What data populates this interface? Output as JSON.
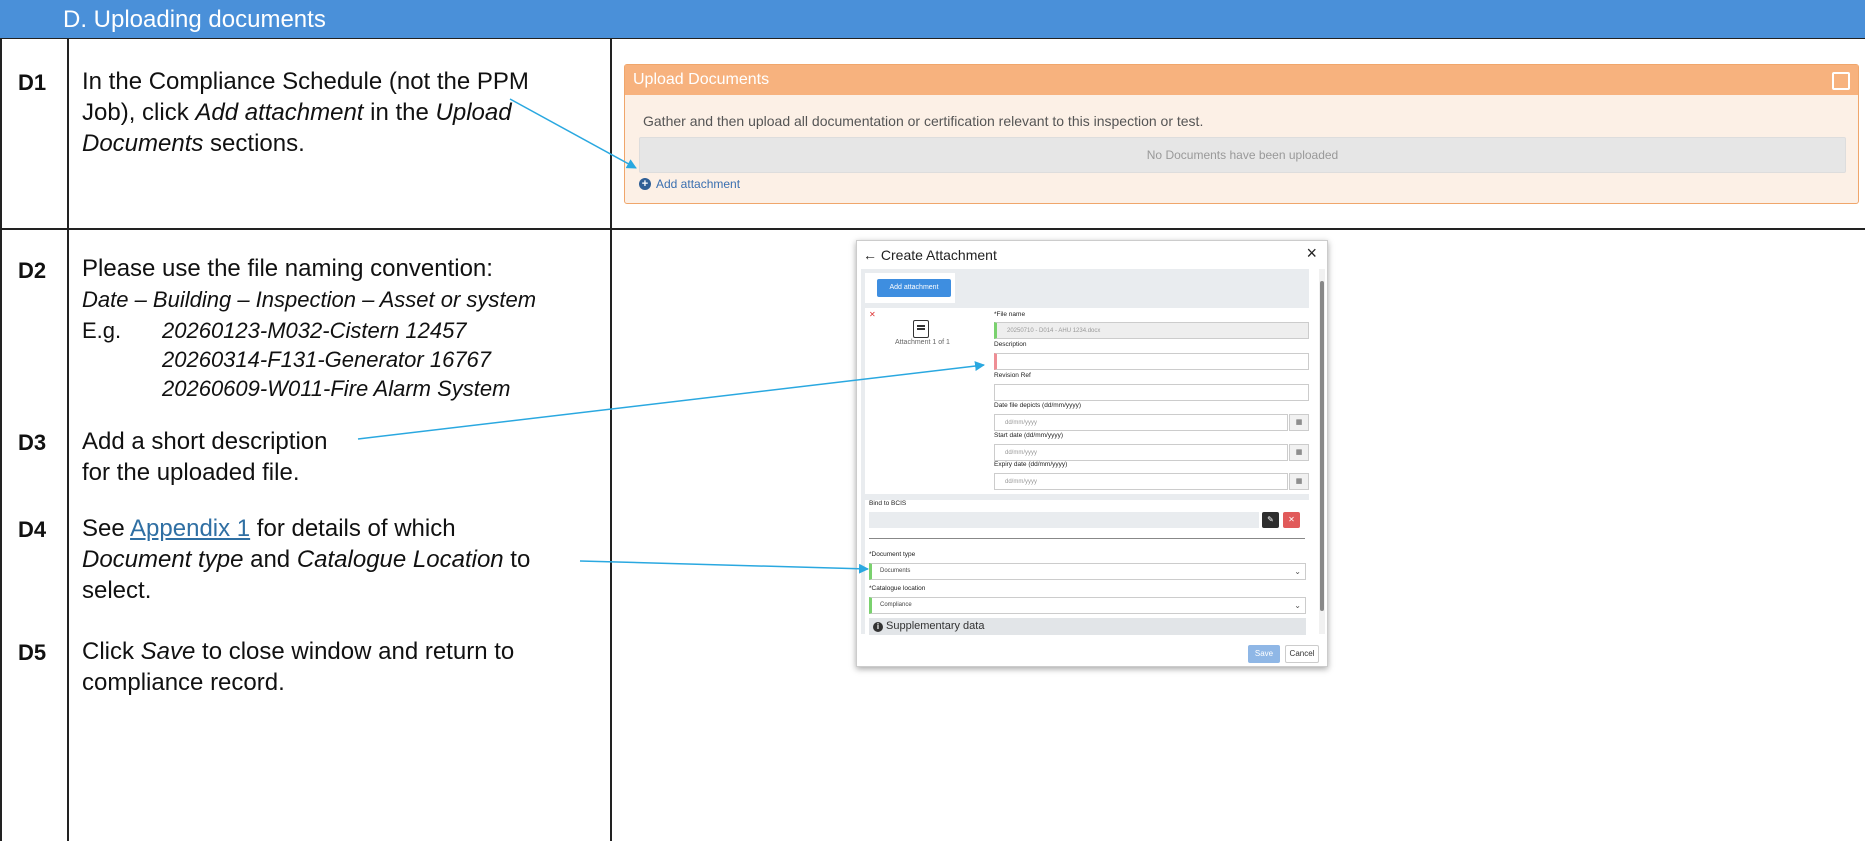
{
  "section": {
    "title": "D.  Uploading documents"
  },
  "steps": {
    "d1": {
      "id": "D1",
      "line1_a": "In the Compliance Schedule (not the PPM",
      "line2_a": "Job), click ",
      "line2_b": "Add attachment",
      "line2_c": " in the ",
      "line2_d": "Upload",
      "line3_a": "Documents",
      "line3_b": " sections."
    },
    "d2": {
      "id": "D2",
      "line1": "Please use the file naming convention:",
      "line2": "Date – Building – Inspection – Asset or system",
      "eg_label": "E.g.",
      "examples": [
        "20260123-M032-Cistern 12457",
        "20260314-F131-Generator 16767",
        "20260609-W011-Fire Alarm System"
      ]
    },
    "d3": {
      "id": "D3",
      "line1": "Add a short description",
      "line2": "for the uploaded file."
    },
    "d4": {
      "id": "D4",
      "see": "See ",
      "link": "Appendix 1",
      "rest": " for details of which",
      "line2_a": "Document type",
      "line2_b": " and ",
      "line2_c": "Catalogue Location",
      "line2_d": " to",
      "line3": "select."
    },
    "d5": {
      "id": "D5",
      "line1_a": "Click ",
      "line1_b": "Save",
      "line1_c": " to close window and return to",
      "line2": "compliance record."
    }
  },
  "upload_panel": {
    "title": "Upload Documents",
    "description": "Gather and then upload all documentation or certification relevant to this inspection or test.",
    "empty_text": "No Documents have been uploaded",
    "add_attachment": "Add attachment"
  },
  "dialog": {
    "title": "← Create Attachment",
    "close": "×",
    "add_attachment_btn": "Add attachment",
    "attachment_count": "Attachment 1 of 1",
    "file_name_label": "*File name",
    "file_name_value": "20250710 - D014 - AHU 1234.docx",
    "description_label": "Description",
    "revision_label": "Revision Ref",
    "date_depicts_label": "Date file depicts (dd/mm/yyyy)",
    "start_date_label": "Start date (dd/mm/yyyy)",
    "expiry_date_label": "Expiry date (dd/mm/yyyy)",
    "date_placeholder": "dd/mm/yyyy",
    "bind_label": "Bind to BCIS",
    "document_type_label": "*Document type",
    "document_type_value": "Documents",
    "catalogue_label": "*Catalogue location",
    "catalogue_value": "Compliance",
    "supplementary": "Supplementary data",
    "save": "Save",
    "cancel": "Cancel"
  },
  "colors": {
    "header": "#4a90d9",
    "upload_panel_head": "#f7b27e",
    "arrow": "#2aa8e0",
    "link": "#2f6fa3"
  }
}
